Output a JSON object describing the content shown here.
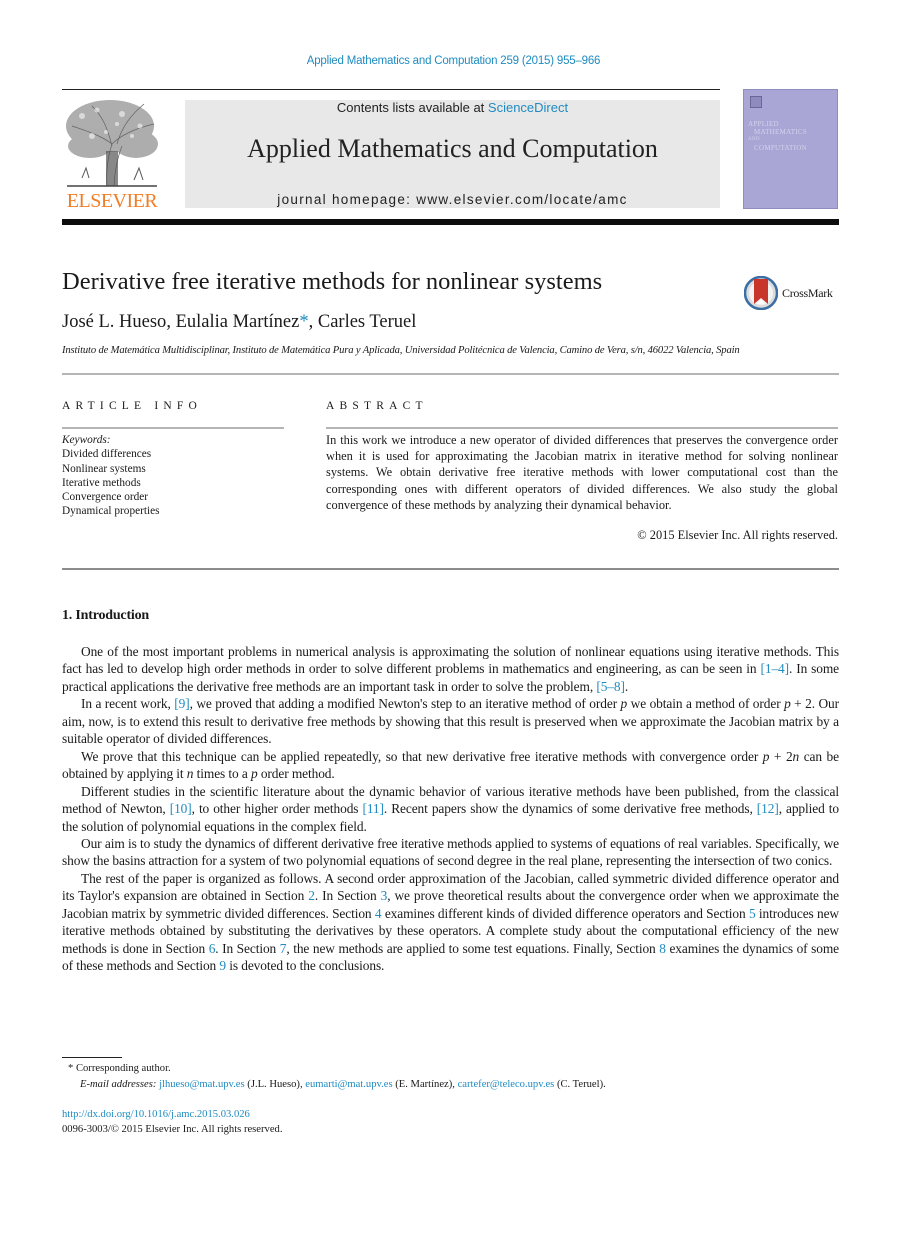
{
  "journal_ref": "Applied Mathematics and Computation 259 (2015) 955–966",
  "header": {
    "publisher_logo_text": "ELSEVIER",
    "contents_prefix": "Contents lists available at ",
    "contents_link": "ScienceDirect",
    "journal_title": "Applied Mathematics and Computation",
    "homepage": "journal homepage: www.elsevier.com/locate/amc",
    "cover_lines": [
      "APPLIED",
      "MATHEMATICS",
      "AND",
      "COMPUTATION"
    ]
  },
  "article": {
    "title": "Derivative free iterative methods for nonlinear systems",
    "crossmark_label": "CrossMark",
    "authors": [
      {
        "name": "José L. Hueso",
        "sep": ", "
      },
      {
        "name": "Eulalia Martínez",
        "mark": "*",
        "sep": ", "
      },
      {
        "name": "Carles Teruel",
        "sep": ""
      }
    ],
    "affiliation": "Instituto de Matemática Multidisciplinar, Instituto de Matemática Pura y Aplicada, Universidad Politécnica de Valencia, Camino de Vera, s/n, 46022 Valencia, Spain"
  },
  "article_info": {
    "label": "ARTICLE INFO",
    "keywords_label": "Keywords:",
    "keywords": [
      "Divided differences",
      "Nonlinear systems",
      "Iterative methods",
      "Convergence order",
      "Dynamical properties"
    ]
  },
  "abstract": {
    "label": "ABSTRACT",
    "text": "In this work we introduce a new operator of divided differences that preserves the conver­gence order when it is used for approximating the Jacobian matrix in iterative method for solving nonlinear systems. We obtain derivative free iterative methods with lower computational cost than the corresponding ones with different operators of divided differ­ences. We also study the global convergence of these methods by analyzing their dynami­cal behavior.",
    "copyright": "© 2015 Elsevier Inc. All rights reserved."
  },
  "section": {
    "heading": "1. Introduction",
    "paragraphs": [
      [
        {
          "t": "One of the most important problems in numerical analysis is approximating the solution of nonlinear equations using iterative methods. This fact has led to develop high order methods in order to solve different problems in mathematics and engineering, as can be seen in "
        },
        {
          "t": "[1–4]",
          "link": true
        },
        {
          "t": ". In some practical applications the derivative free methods are an important task in order to solve the problem, "
        },
        {
          "t": "[5–8]",
          "link": true
        },
        {
          "t": "."
        }
      ],
      [
        {
          "t": "In a recent work, "
        },
        {
          "t": "[9]",
          "link": true
        },
        {
          "t": ", we proved that adding a modified Newton's step to an iterative method of order "
        },
        {
          "t": "p",
          "ital": true
        },
        {
          "t": " we obtain a method of order "
        },
        {
          "t": "p",
          "ital": true
        },
        {
          "t": " + 2. Our aim, now, is to extend this result to derivative free methods by showing that this result is pre­served when we approximate the Jacobian matrix by a suitable operator of divided differences."
        }
      ],
      [
        {
          "t": "We prove that this technique can be applied repeatedly, so that new derivative free iterative methods with convergence order "
        },
        {
          "t": "p",
          "ital": true
        },
        {
          "t": " + 2"
        },
        {
          "t": "n",
          "ital": true
        },
        {
          "t": " can be obtained by applying it "
        },
        {
          "t": "n",
          "ital": true
        },
        {
          "t": " times to a "
        },
        {
          "t": "p",
          "ital": true
        },
        {
          "t": " order method."
        }
      ],
      [
        {
          "t": "Different studies in the scientific literature about the dynamic behavior of various iterative methods have been published, from the classical method of Newton, "
        },
        {
          "t": "[10]",
          "link": true
        },
        {
          "t": ", to other higher order methods "
        },
        {
          "t": "[11]",
          "link": true
        },
        {
          "t": ". Recent papers show the dynamics of some derivative free methods, "
        },
        {
          "t": "[12]",
          "link": true
        },
        {
          "t": ", applied to the solution of polynomial equations in the complex field."
        }
      ],
      [
        {
          "t": "Our aim is to study the dynamics of different derivative free iterative methods applied to systems of equations of real variables. Specifically, we show the basins attraction for a system of two polynomial equations of second degree in the real plane, representing the intersection of two conics."
        }
      ],
      [
        {
          "t": "The rest of the paper is organized as follows. A second order approximation of the Jacobian, called symmetric divided dif­ference operator and its Taylor's expansion are obtained in Section "
        },
        {
          "t": "2",
          "link": true
        },
        {
          "t": ". In Section "
        },
        {
          "t": "3",
          "link": true
        },
        {
          "t": ", we prove theoretical results about the convergence order when we approximate the Jacobian matrix by symmetric divided differences. Section "
        },
        {
          "t": "4",
          "link": true
        },
        {
          "t": " examines differ­ent kinds of divided difference operators and Section "
        },
        {
          "t": "5",
          "link": true
        },
        {
          "t": " introduces new iterative methods obtained by substituting the derivatives by these operators. A complete study about the computational efficiency of the new methods is done in Section "
        },
        {
          "t": "6",
          "link": true
        },
        {
          "t": ". In Section "
        },
        {
          "t": "7",
          "link": true
        },
        {
          "t": ", the new methods are applied to some test equations. Finally, Section "
        },
        {
          "t": "8",
          "link": true
        },
        {
          "t": " examines the dynamics of some of these methods and Section "
        },
        {
          "t": "9",
          "link": true
        },
        {
          "t": " is devoted to the conclusions."
        }
      ]
    ]
  },
  "footnotes": {
    "corresponding": "* Corresponding author.",
    "email_label": "E-mail addresses:",
    "emails": [
      {
        "address": "jlhueso@mat.upv.es",
        "who": " (J.L. Hueso), "
      },
      {
        "address": "eumarti@mat.upv.es",
        "who": " (E. Martínez), "
      },
      {
        "address": "cartefer@teleco.upv.es",
        "who": " (C. Teruel)."
      }
    ]
  },
  "doi": "http://dx.doi.org/10.1016/j.amc.2015.03.026",
  "issn_line": "0096-3003/© 2015 Elsevier Inc. All rights reserved.",
  "colors": {
    "link": "#1f8bc0",
    "elsevier_orange": "#f07e26",
    "cover": "#a9a6d5",
    "banner": "#e8e8e8"
  }
}
